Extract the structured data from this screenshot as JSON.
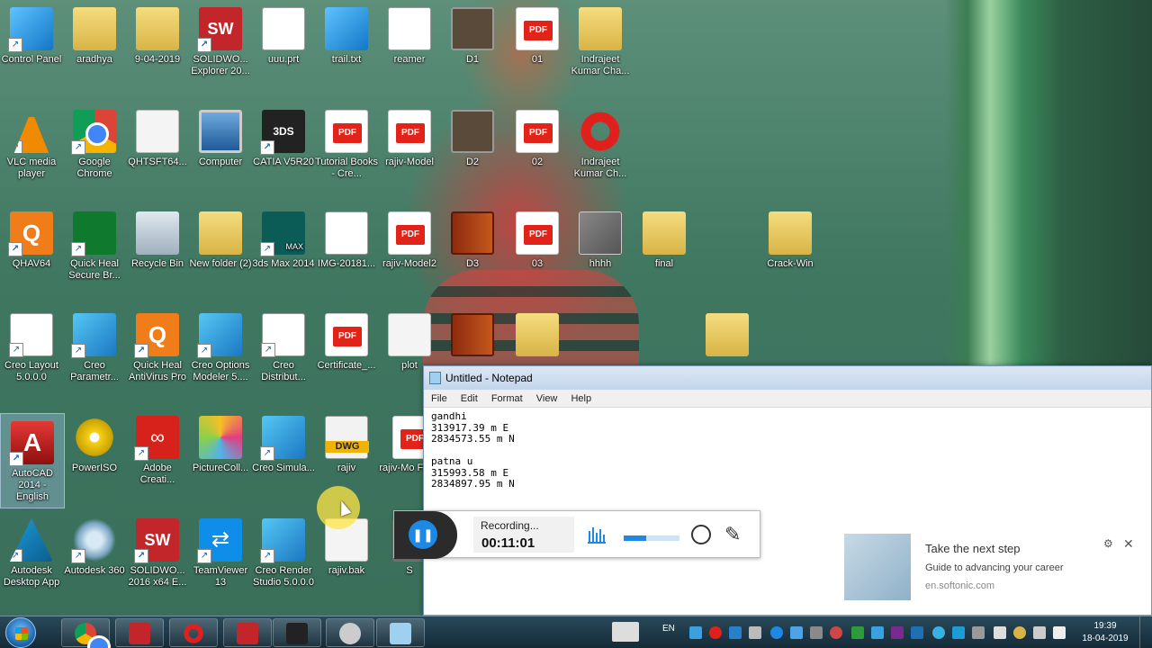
{
  "desktop": {
    "icons": [
      {
        "label": "Control Panel"
      },
      {
        "label": "aradhya"
      },
      {
        "label": "9-04-2019"
      },
      {
        "label": "SOLIDWO... Explorer 20..."
      },
      {
        "label": "uuu.prt"
      },
      {
        "label": "trail.txt"
      },
      {
        "label": "reamer"
      },
      {
        "label": "D1"
      },
      {
        "label": "01"
      },
      {
        "label": "Indrajeet Kumar Cha..."
      },
      {
        "label": "VLC media player"
      },
      {
        "label": "Google Chrome"
      },
      {
        "label": "QHTSFT64..."
      },
      {
        "label": "Computer"
      },
      {
        "label": "CATIA V5R20"
      },
      {
        "label": "Tutorial Books - Cre..."
      },
      {
        "label": "rajiv-Model"
      },
      {
        "label": "D2"
      },
      {
        "label": "02"
      },
      {
        "label": "Indrajeet Kumar Ch..."
      },
      {
        "label": "QHAV64"
      },
      {
        "label": "Quick Heal Secure Br..."
      },
      {
        "label": "Recycle Bin"
      },
      {
        "label": "New folder (2)"
      },
      {
        "label": "3ds Max 2014"
      },
      {
        "label": "IMG-20181..."
      },
      {
        "label": "rajiv-Model2"
      },
      {
        "label": "D3"
      },
      {
        "label": "03"
      },
      {
        "label": "hhhh"
      },
      {
        "label": "final"
      },
      {
        "label": "Crack-Win"
      },
      {
        "label": "Creo Layout 5.0.0.0"
      },
      {
        "label": "Creo Parametr..."
      },
      {
        "label": "Quick Heal AntiVirus Pro"
      },
      {
        "label": "Creo Options Modeler 5...."
      },
      {
        "label": "Creo Distribut..."
      },
      {
        "label": "Certificate_..."
      },
      {
        "label": "plot"
      },
      {
        "label": "AutoCAD 2014 - English"
      },
      {
        "label": "PowerISO"
      },
      {
        "label": "Adobe Creati..."
      },
      {
        "label": "PictureColl..."
      },
      {
        "label": "Creo Simula..."
      },
      {
        "label": "rajiv"
      },
      {
        "label": "rajiv-Mo FINA"
      },
      {
        "label": "Autodesk Desktop App"
      },
      {
        "label": "Autodesk 360"
      },
      {
        "label": "SOLIDWO... 2016 x64 E..."
      },
      {
        "label": "TeamViewer 13"
      },
      {
        "label": "Creo Render Studio 5.0.0.0"
      },
      {
        "label": "rajiv.bak"
      },
      {
        "label": "S"
      }
    ],
    "badges": {
      "sw": "SW",
      "sw_year": "2016",
      "pdf": "PDF",
      "max": "MAX",
      "dwg": "DWG"
    }
  },
  "notepad": {
    "title": "Untitled - Notepad",
    "menu": [
      "File",
      "Edit",
      "Format",
      "View",
      "Help"
    ],
    "text": "gandhi\n313917.39 m E\n2834573.55 m N\n\npatna u\n315993.58 m E\n2834897.95 m N"
  },
  "recorder": {
    "status": "Recording...",
    "time": "00:11:01",
    "volume_level": 0.4
  },
  "ad": {
    "title": "Take the next step",
    "subtitle": "Guide to advancing your career",
    "source": "en.softonic.com"
  },
  "taskbar": {
    "language": "EN",
    "time": "19:39",
    "date": "18-04-2019"
  },
  "colors": {
    "accent": "#1e88e5",
    "taskbar": "#1a3a4e",
    "pdf_red": "#e2231a"
  }
}
